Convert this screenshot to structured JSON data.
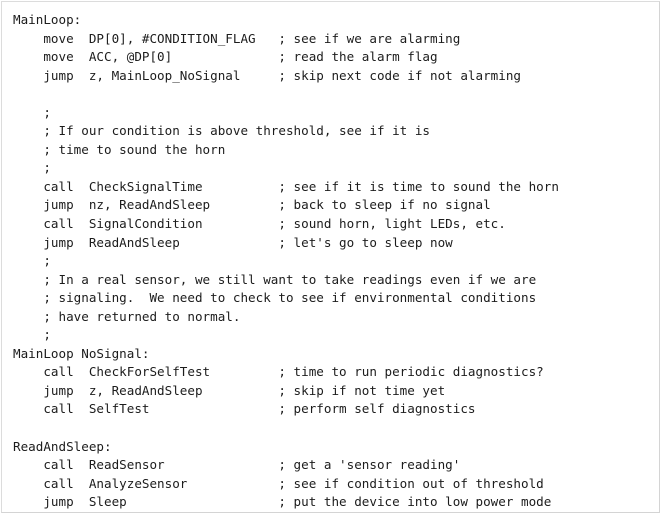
{
  "document": {
    "kind": "code-listing",
    "language": "assembly",
    "title": "MainLoop assembly routine",
    "background_color": "#ffffff",
    "text_color": "#1c1c1c",
    "border_color": "#d9d9d9"
  },
  "code": {
    "lines": [
      "MainLoop:",
      "    move  DP[0], #CONDITION_FLAG   ; see if we are alarming",
      "    move  ACC, @DP[0]              ; read the alarm flag",
      "    jump  z, MainLoop_NoSignal     ; skip next code if not alarming",
      "",
      "    ;",
      "    ; If our condition is above threshold, see if it is",
      "    ; time to sound the horn",
      "    ;",
      "    call  CheckSignalTime          ; see if it is time to sound the horn",
      "    jump  nz, ReadAndSleep         ; back to sleep if no signal",
      "    call  SignalCondition          ; sound horn, light LEDs, etc.",
      "    jump  ReadAndSleep             ; let's go to sleep now",
      "    ;",
      "    ; In a real sensor, we still want to take readings even if we are",
      "    ; signaling.  We need to check to see if environmental conditions",
      "    ; have returned to normal.",
      "    ;",
      "MainLoop NoSignal:",
      "    call  CheckForSelfTest         ; time to run periodic diagnostics?",
      "    jump  z, ReadAndSleep          ; skip if not time yet",
      "    call  SelfTest                 ; perform self diagnostics",
      "",
      "ReadAndSleep:",
      "    call  ReadSensor               ; get a 'sensor reading'",
      "    call  AnalyzeSensor            ; see if condition out of threshold",
      "    jump  Sleep                    ; put the device into low power mode"
    ]
  }
}
